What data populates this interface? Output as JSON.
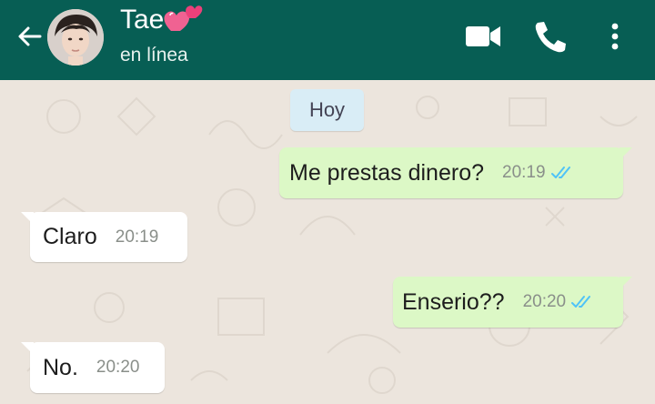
{
  "header": {
    "contact_name": "Tae",
    "status": "en línea",
    "icons": {
      "back": "arrow-left-icon",
      "heart": "two-hearts-emoji",
      "video": "video-camera-icon",
      "call": "phone-icon",
      "menu": "more-vertical-icon"
    },
    "color": "#075e54"
  },
  "chat": {
    "date_label": "Hoy",
    "colors": {
      "outgoing": "#dcf8c6",
      "incoming": "#ffffff",
      "read_ticks": "#4fc3f7",
      "background": "#ece5dd"
    },
    "messages": [
      {
        "direction": "outgoing",
        "text": "Me prestas dinero?",
        "time": "20:19",
        "status": "read"
      },
      {
        "direction": "incoming",
        "text": "Claro",
        "time": "20:19"
      },
      {
        "direction": "outgoing",
        "text": "Enserio??",
        "time": "20:20",
        "status": "read"
      },
      {
        "direction": "incoming",
        "text": "No.",
        "time": "20:20"
      }
    ]
  }
}
